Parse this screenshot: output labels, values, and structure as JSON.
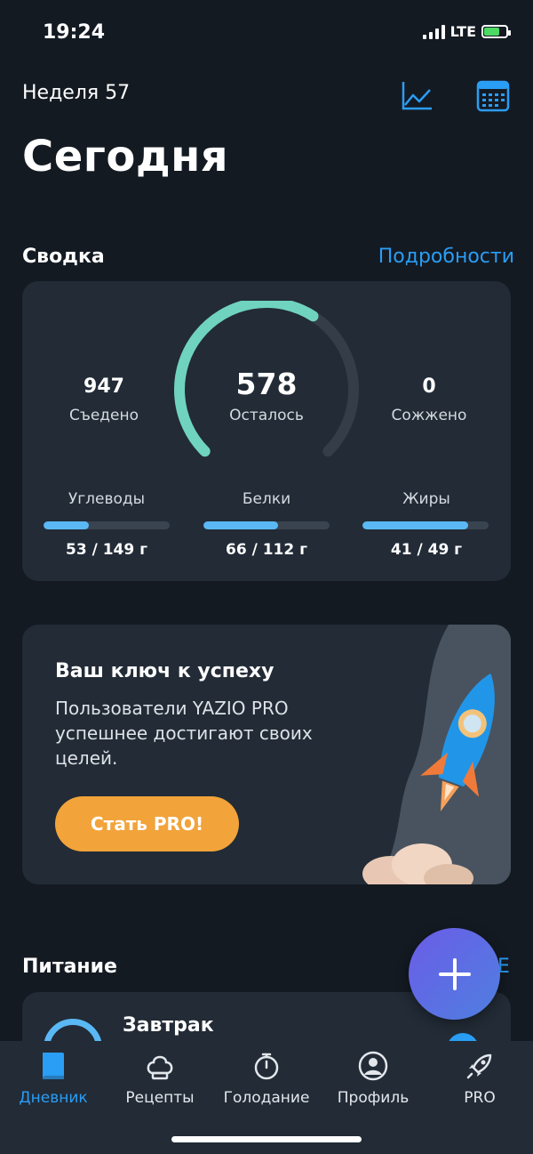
{
  "status_bar": {
    "time": "19:24",
    "network": "LTE"
  },
  "header": {
    "week": "Неделя 57",
    "title": "Сегодня"
  },
  "summary": {
    "title": "Сводка",
    "details_link": "Подробности",
    "eaten": {
      "value": "947",
      "label": "Съедено"
    },
    "remaining": {
      "value": "578",
      "label": "Осталось"
    },
    "burned": {
      "value": "0",
      "label": "Сожжено"
    },
    "gauge_fraction": 0.62,
    "macros": [
      {
        "label": "Углеводы",
        "value": "53 / 149 г",
        "fraction": 0.36
      },
      {
        "label": "Белки",
        "value": "66 / 112 г",
        "fraction": 0.59
      },
      {
        "label": "Жиры",
        "value": "41 / 49 г",
        "fraction": 0.84
      }
    ]
  },
  "promo": {
    "title": "Ваш ключ к успеху",
    "text": "Пользователи YAZIO PRO успешнее достигают своих целей.",
    "button": "Стать PRO!"
  },
  "nutrition": {
    "title": "Питание",
    "link_partial": "Е",
    "meal": "Завтрак"
  },
  "tabs": [
    {
      "label": "Дневник",
      "icon": "book-icon",
      "active": true
    },
    {
      "label": "Рецепты",
      "icon": "chef-hat-icon",
      "active": false
    },
    {
      "label": "Голодание",
      "icon": "stopwatch-icon",
      "active": false
    },
    {
      "label": "Профиль",
      "icon": "profile-icon",
      "active": false
    },
    {
      "label": "PRO",
      "icon": "rocket-icon",
      "active": false
    }
  ],
  "colors": {
    "accent": "#2a9df4",
    "gauge": "#6fd3bf",
    "macro_bar": "#5ab8f5",
    "pro_button": "#f2a33a",
    "background": "#141a22",
    "card": "#222b36"
  }
}
